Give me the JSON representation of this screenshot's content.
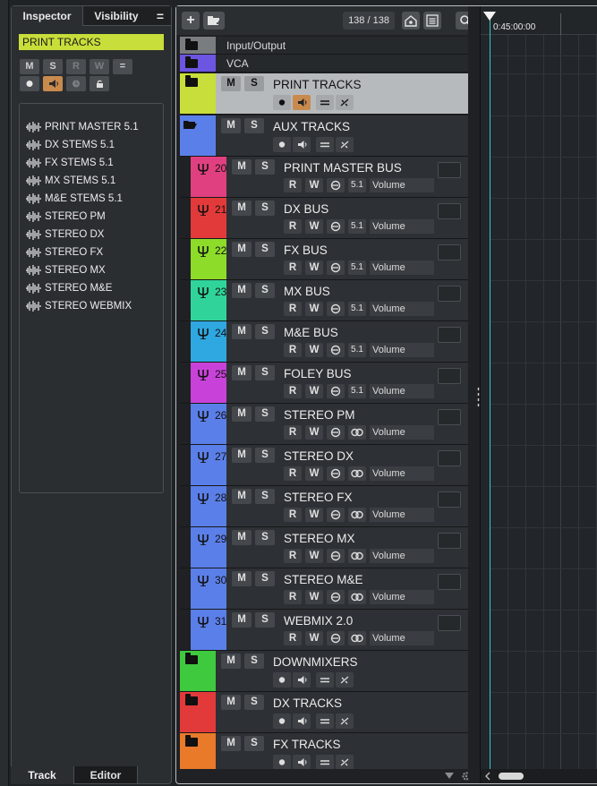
{
  "inspector": {
    "tab_inspector": "Inspector",
    "tab_visibility": "Visibility",
    "menu": "=",
    "selected_track": "PRINT TRACKS",
    "buttons_row1": [
      "M",
      "S",
      "R",
      "W",
      "="
    ],
    "outputs": [
      "PRINT MASTER 5.1",
      "DX STEMS 5.1",
      "FX STEMS 5.1",
      "MX STEMS 5.1",
      "M&E STEMS 5.1",
      "STEREO PM",
      "STEREO DX",
      "STEREO FX",
      "STEREO MX",
      "STEREO M&E",
      "STEREO WEBMIX"
    ]
  },
  "bottom_tabs": {
    "track": "Track",
    "editor": "Editor"
  },
  "toolbar": {
    "add": "+",
    "counter": "138 / 138"
  },
  "ruler": {
    "time": "0:45:00:00"
  },
  "colors": {
    "accent_lime": "#c8de3a",
    "cursor": "#39c6cf",
    "monitor_orange": "#c98a4e"
  },
  "tracks": {
    "t0": {
      "name": "Input/Output"
    },
    "t1": {
      "name": "VCA"
    },
    "t2": {
      "name": "PRINT TRACKS",
      "m": "M",
      "s": "S"
    },
    "t3": {
      "name": "AUX TRACKS",
      "m": "M",
      "s": "S"
    },
    "t4": {
      "num": "20",
      "name": "PRINT MASTER BUS",
      "m": "M",
      "s": "S",
      "r": "R",
      "w": "W",
      "ch": "5.1",
      "auto": "Volume"
    },
    "t5": {
      "num": "21",
      "name": "DX BUS",
      "m": "M",
      "s": "S",
      "r": "R",
      "w": "W",
      "ch": "5.1",
      "auto": "Volume"
    },
    "t6": {
      "num": "22",
      "name": "FX BUS",
      "m": "M",
      "s": "S",
      "r": "R",
      "w": "W",
      "ch": "5.1",
      "auto": "Volume"
    },
    "t7": {
      "num": "23",
      "name": "MX BUS",
      "m": "M",
      "s": "S",
      "r": "R",
      "w": "W",
      "ch": "5.1",
      "auto": "Volume"
    },
    "t8": {
      "num": "24",
      "name": "M&E BUS",
      "m": "M",
      "s": "S",
      "r": "R",
      "w": "W",
      "ch": "5.1",
      "auto": "Volume"
    },
    "t9": {
      "num": "25",
      "name": "FOLEY BUS",
      "m": "M",
      "s": "S",
      "r": "R",
      "w": "W",
      "ch": "5.1",
      "auto": "Volume"
    },
    "t10": {
      "num": "26",
      "name": "STEREO PM",
      "m": "M",
      "s": "S",
      "r": "R",
      "w": "W",
      "auto": "Volume"
    },
    "t11": {
      "num": "27",
      "name": "STEREO DX",
      "m": "M",
      "s": "S",
      "r": "R",
      "w": "W",
      "auto": "Volume"
    },
    "t12": {
      "num": "28",
      "name": "STEREO FX",
      "m": "M",
      "s": "S",
      "r": "R",
      "w": "W",
      "auto": "Volume"
    },
    "t13": {
      "num": "29",
      "name": "STEREO MX",
      "m": "M",
      "s": "S",
      "r": "R",
      "w": "W",
      "auto": "Volume"
    },
    "t14": {
      "num": "30",
      "name": "STEREO M&E",
      "m": "M",
      "s": "S",
      "r": "R",
      "w": "W",
      "auto": "Volume"
    },
    "t15": {
      "num": "31",
      "name": "WEBMIX 2.0",
      "m": "M",
      "s": "S",
      "r": "R",
      "w": "W",
      "auto": "Volume"
    },
    "t16": {
      "name": "DOWNMIXERS",
      "m": "M",
      "s": "S"
    },
    "t17": {
      "name": "DX TRACKS",
      "m": "M",
      "s": "S"
    },
    "t18": {
      "name": "FX TRACKS",
      "m": "M",
      "s": "S"
    }
  }
}
